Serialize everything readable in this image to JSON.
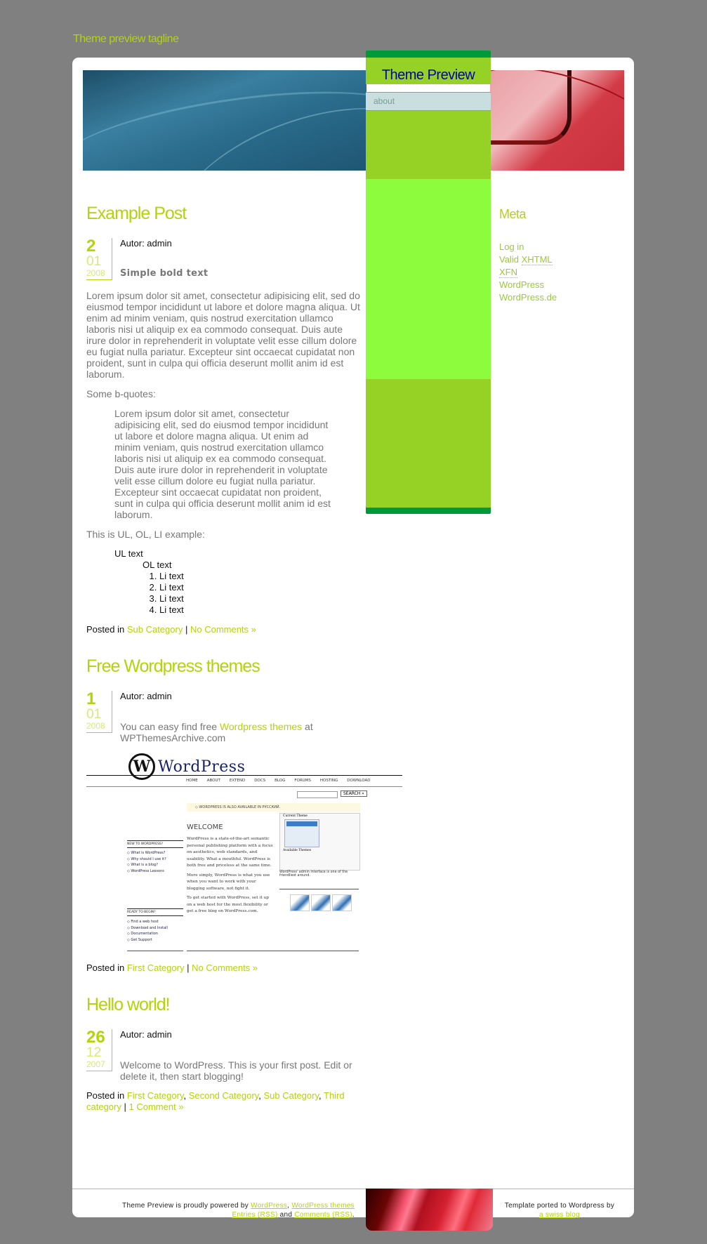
{
  "site": {
    "tagline": "Theme preview tagline",
    "title": "Theme Preview",
    "nav": [
      {
        "label": "about"
      }
    ]
  },
  "colors": {
    "accent": "#b3d30a",
    "page_bg": "#808080",
    "sidebar_green": "#96d225",
    "sidebar_bright": "#8cfc3c",
    "sidebar_dark": "#00993a",
    "title_blue": "#0000aa"
  },
  "posts": [
    {
      "title": "Example Post",
      "date": {
        "day": "2",
        "month": "01",
        "year": "2008"
      },
      "author_label": "Autor: admin",
      "bold_text": "Simple bold text",
      "paragraph": "Lorem ipsum dolor sit amet, consectetur adipisicing elit, sed do eiusmod tempor incididunt ut labore et dolore magna aliqua. Ut enim ad minim veniam, quis nostrud exercitation ullamco laboris nisi ut aliquip ex ea commodo consequat. Duis aute irure dolor in reprehenderit in voluptate velit esse cillum dolore eu fugiat nulla pariatur. Excepteur sint occaecat cupidatat non proident, sunt in culpa qui officia deserunt mollit anim id est laborum.",
      "bquote_intro": "Some b-quotes:",
      "blockquote": "Lorem ipsum dolor sit amet, consectetur adipisicing elit, sed do eiusmod tempor incididunt ut labore et dolore magna aliqua. Ut enim ad minim veniam, quis nostrud exercitation ullamco laboris nisi ut aliquip ex ea commodo consequat. Duis aute irure dolor in reprehenderit in voluptate velit esse cillum dolore eu fugiat nulla pariatur. Excepteur sint occaecat cupidatat non proident, sunt in culpa qui officia deserunt mollit anim id est laborum.",
      "list_intro": "This is UL, OL, LI example:",
      "ul_text": "UL text",
      "ol_text": "OL text",
      "li_items": [
        "Li text",
        "Li text",
        "Li text",
        "Li text"
      ],
      "posted_in": "Posted in",
      "categories": [
        "Sub Category"
      ],
      "separator": "|",
      "comments": "No Comments »"
    },
    {
      "title": "Free Wordpress themes",
      "date": {
        "day": "1",
        "month": "01",
        "year": "2008"
      },
      "author_label": "Autor: admin",
      "text_before": "You can easy find free",
      "link_text": "Wordpress themes",
      "text_after": "at WPThemesArchive.com",
      "screenshot": {
        "logo": "WordPress",
        "nav": [
          "HOME",
          "ABOUT",
          "EXTEND",
          "DOCS",
          "BLOG",
          "FORUMS",
          "HOSTING",
          "DOWNLOAD"
        ],
        "search_button": "SEARCH »",
        "notice": "◇ WORDPRESS IS ALSO AVAILABLE IN РУССКИЙ.",
        "welcome": "WELCOME",
        "body1": "WordPress is a state-of-the-art semantic personal publishing platform with a focus on aesthetics, web standards, and usability. What a mouthful. WordPress is both free and priceless at the same time.",
        "body2": "More simply, WordPress is what you use when you want to work with your blogging software, not fight it.",
        "body3": "To get started with WordPress, set it up on a web host for the most flexibility or get a free blog on WordPress.com.",
        "new_heading": "NEW TO WORDPRESS?",
        "new_links": [
          "◇ What is WordPress?",
          "◇ Why should I use it?",
          "◇ What is a blog?",
          "◇ WordPress Lessons"
        ],
        "ready_heading": "READY TO BEGIN?",
        "ready_links": [
          "◇ Find a web host",
          "◇ Download and Install",
          "◇ Documentation",
          "◇ Get Support"
        ],
        "current_theme": "Current Theme",
        "available_themes": "Available Themes",
        "caption": "WordPress' admin interface is one of the friendliest around."
      },
      "posted_in": "Posted in",
      "categories": [
        "First Category"
      ],
      "separator": "|",
      "comments": "No Comments »"
    },
    {
      "title": "Hello world!",
      "date": {
        "day": "26",
        "month": "12",
        "year": "2007"
      },
      "author_label": "Autor: admin",
      "paragraph": "Welcome to WordPress. This is your first post. Edit or delete it, then start blogging!",
      "posted_in": "Posted in",
      "categories": [
        "First Category",
        "Second Category",
        "Sub Category",
        "Third category"
      ],
      "separator": "|",
      "comments": "1 Comment »"
    }
  ],
  "meta_widget": {
    "title": "Meta",
    "links": [
      {
        "label": "Log in"
      },
      {
        "prefix": "Valid ",
        "abbr": "XHTML"
      },
      {
        "abbr": "XFN"
      },
      {
        "label": "WordPress"
      },
      {
        "label": "WordPress.de"
      }
    ]
  },
  "footer": {
    "powered_prefix": "Theme Preview is proudly powered by",
    "wordpress_link": "WordPress",
    "comma": ",",
    "themes_link": "WordPress themes",
    "entries_link": "Entries (RSS)",
    "and": "and",
    "comments_link": "Comments (RSS)",
    "period": ".",
    "ported_text": "Template ported to Wordpress by",
    "ported_link": "a swiss blog"
  }
}
